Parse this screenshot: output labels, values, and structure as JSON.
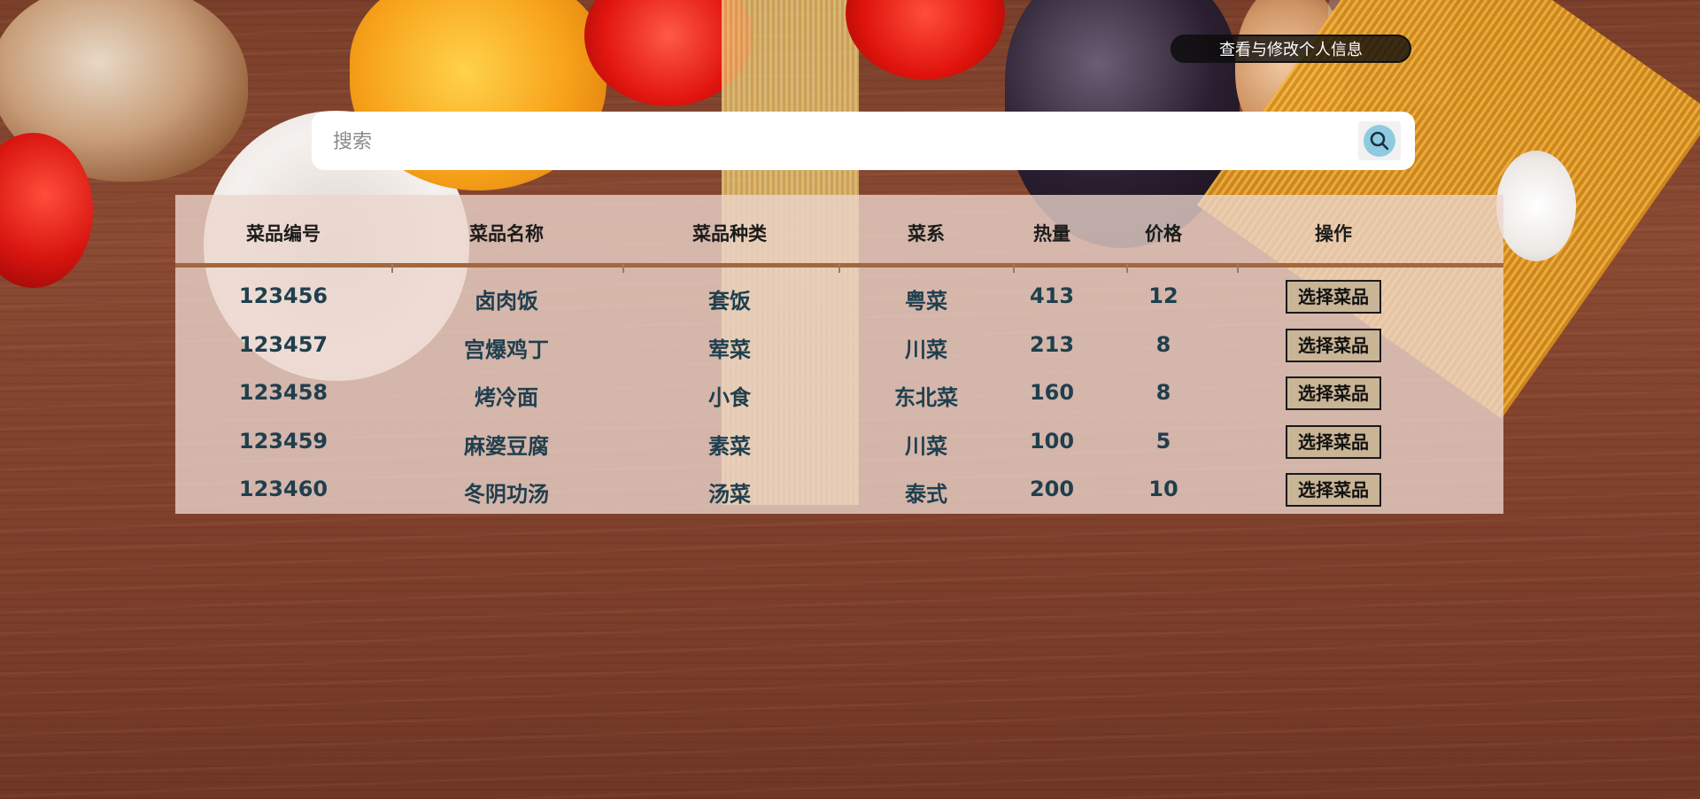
{
  "header": {
    "profile_button_label": "查看与修改个人信息"
  },
  "search": {
    "placeholder": "搜索"
  },
  "table": {
    "headers": [
      "菜品编号",
      "菜品名称",
      "菜品种类",
      "菜系",
      "热量",
      "价格",
      "操作"
    ],
    "rows": [
      {
        "id": "123456",
        "name": "卤肉饭",
        "category": "套饭",
        "cuisine": "粤菜",
        "calories": "413",
        "price": "12",
        "action": "选择菜品"
      },
      {
        "id": "123457",
        "name": "宫爆鸡丁",
        "category": "荤菜",
        "cuisine": "川菜",
        "calories": "213",
        "price": "8",
        "action": "选择菜品"
      },
      {
        "id": "123458",
        "name": "烤冷面",
        "category": "小食",
        "cuisine": "东北菜",
        "calories": "160",
        "price": "8",
        "action": "选择菜品"
      },
      {
        "id": "123459",
        "name": "麻婆豆腐",
        "category": "素菜",
        "cuisine": "川菜",
        "calories": "100",
        "price": "5",
        "action": "选择菜品"
      },
      {
        "id": "123460",
        "name": "冬阴功汤",
        "category": "汤菜",
        "cuisine": "泰式",
        "calories": "200",
        "price": "10",
        "action": "选择菜品"
      }
    ]
  },
  "colors": {
    "accent_rule": "#a3673f",
    "cell_text": "#1f3f4e",
    "select_button_bg": "#c9b496"
  },
  "icons": {
    "search": "magnifier-icon"
  }
}
